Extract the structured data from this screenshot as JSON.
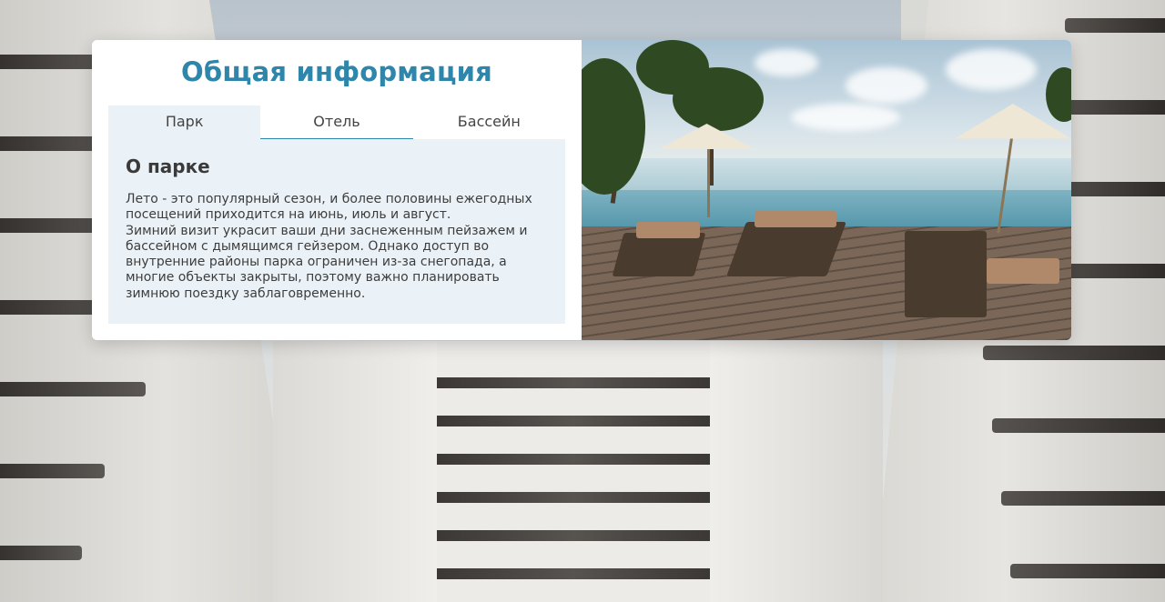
{
  "info": {
    "title": "Общая информация",
    "tabs": [
      {
        "label": "Парк"
      },
      {
        "label": "Отель"
      },
      {
        "label": "Бассейн"
      }
    ],
    "panel": {
      "heading": "О парке",
      "text": "Лето - это популярный сезон, и более половины ежегодных посещений приходится на июнь, июль и август.\nЗимний визит украсит ваши дни заснеженным пейзажем и бассейном с дымящимся гейзером. Однако доступ во внутренние районы парка ограничен из-за снегопада, а многие объекты закрыты, поэтому важно планировать зимнюю поездку заблаговременно."
    }
  },
  "colors": {
    "accent": "#2e86ab",
    "panel_bg": "#ebf2f7",
    "text": "#3d3d3d"
  }
}
